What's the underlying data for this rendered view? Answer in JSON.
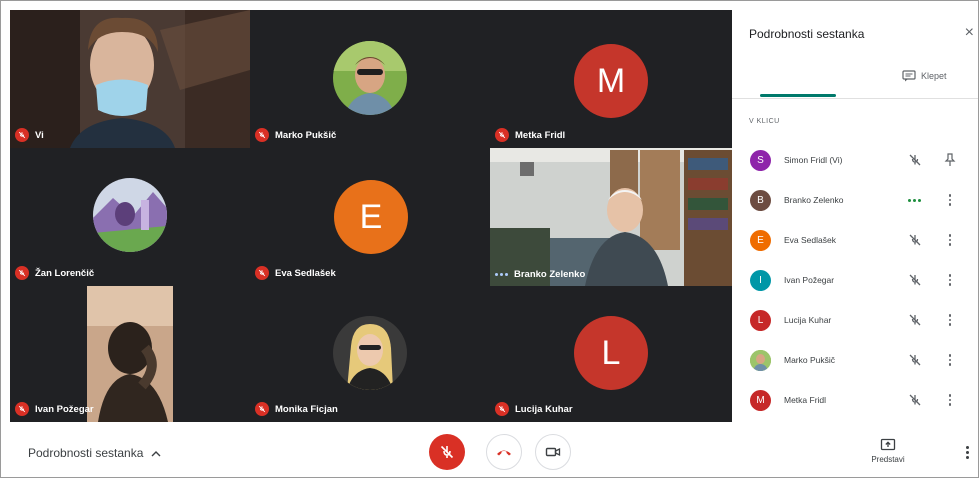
{
  "tiles": [
    {
      "name": "Vi",
      "type": "video"
    },
    {
      "name": "Marko Pukšič",
      "type": "photo"
    },
    {
      "name": "Metka Fridl",
      "type": "letter",
      "letter": "M",
      "color": "#c5362b"
    },
    {
      "name": "Žan Lorenčič",
      "type": "photo"
    },
    {
      "name": "Eva Sedlašek",
      "type": "letter",
      "letter": "E",
      "color": "#e8711a"
    },
    {
      "name": "Branko Zelenko",
      "type": "video"
    },
    {
      "name": "Ivan Požegar",
      "type": "video"
    },
    {
      "name": "Monika Ficjan",
      "type": "photo"
    },
    {
      "name": "Lucija Kuhar",
      "type": "letter",
      "letter": "L",
      "color": "#c5362b"
    }
  ],
  "panel": {
    "title": "Podrobnosti sestanka",
    "close": "×",
    "chat_tab": "Klepet",
    "section": "V KLICU",
    "participants": [
      {
        "name": "Simon Fridl (Vi)",
        "letter": "S",
        "color": "#8e24aa",
        "status": "muted"
      },
      {
        "name": "Branko Zelenko",
        "letter": "B",
        "color": "#6d4c41",
        "status": "speaking"
      },
      {
        "name": "Eva Sedlašek",
        "letter": "E",
        "color": "#ef6c00",
        "status": "muted"
      },
      {
        "name": "Ivan Požegar",
        "letter": "I",
        "color": "#0097a7",
        "status": "muted"
      },
      {
        "name": "Lucija Kuhar",
        "letter": "L",
        "color": "#c62828",
        "status": "muted"
      },
      {
        "name": "Marko Pukšič",
        "letter": "",
        "color": "#7cb342",
        "status": "muted"
      },
      {
        "name": "Metka Fridl",
        "letter": "M",
        "color": "#c62828",
        "status": "muted"
      }
    ]
  },
  "bottombar": {
    "meeting_details": "Podrobnosti sestanka",
    "present_label": "Predstavi"
  },
  "colors": {
    "accent": "#00796b",
    "danger": "#d93025",
    "grid_bg": "#202124"
  }
}
